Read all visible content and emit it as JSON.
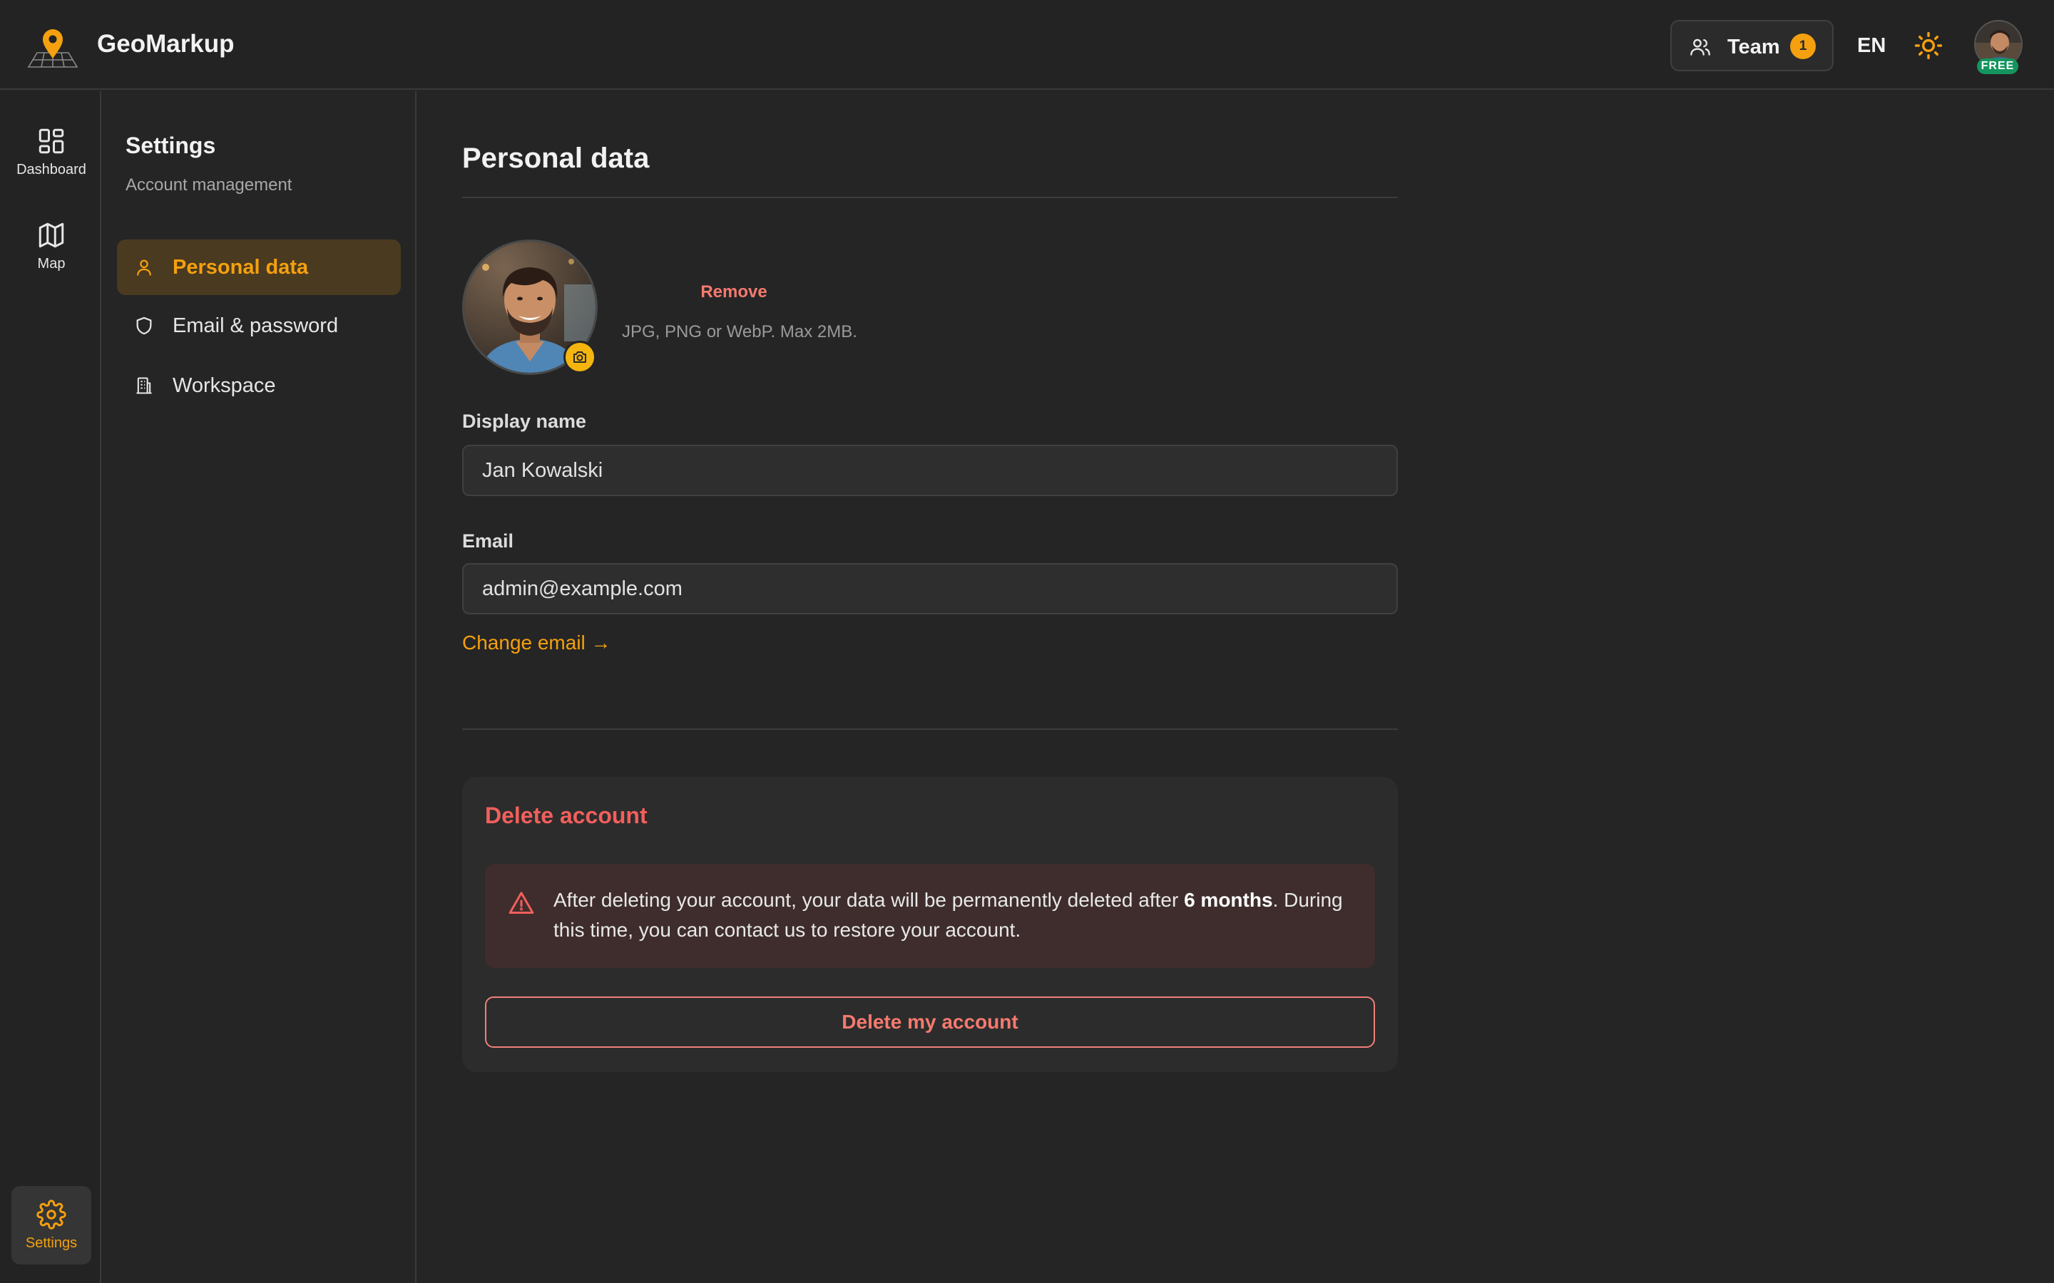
{
  "app": {
    "name": "GeoMarkup"
  },
  "header": {
    "team_label": "Team",
    "team_count": "1",
    "language": "EN",
    "plan_badge": "FREE"
  },
  "rail": {
    "items": [
      {
        "label": "Dashboard",
        "icon": "dashboard-icon"
      },
      {
        "label": "Map",
        "icon": "map-icon"
      },
      {
        "label": "Settings",
        "icon": "gear-icon",
        "active": true
      }
    ]
  },
  "settings_nav": {
    "title": "Settings",
    "subtitle": "Account management",
    "items": [
      {
        "label": "Personal data",
        "icon": "user-icon",
        "active": true
      },
      {
        "label": "Email & password",
        "icon": "shield-icon"
      },
      {
        "label": "Workspace",
        "icon": "building-icon"
      }
    ]
  },
  "main": {
    "title": "Personal data",
    "avatar": {
      "remove_label": "Remove",
      "hint": "JPG, PNG or WebP. Max 2MB."
    },
    "display_name": {
      "label": "Display name",
      "value": "Jan Kowalski"
    },
    "email": {
      "label": "Email",
      "value": "admin@example.com"
    },
    "change_email": "Change email →",
    "delete_account": {
      "title": "Delete account",
      "warning_before": "After deleting your account, your data will be permanently deleted after ",
      "warning_bold": "6 months",
      "warning_after": ". During this time, you can contact us to restore your account.",
      "button": "Delete my account"
    }
  },
  "colors": {
    "accent": "#f5a00f",
    "danger": "#f25f5c",
    "background": "#252525",
    "plan_badge": "#14955f"
  }
}
